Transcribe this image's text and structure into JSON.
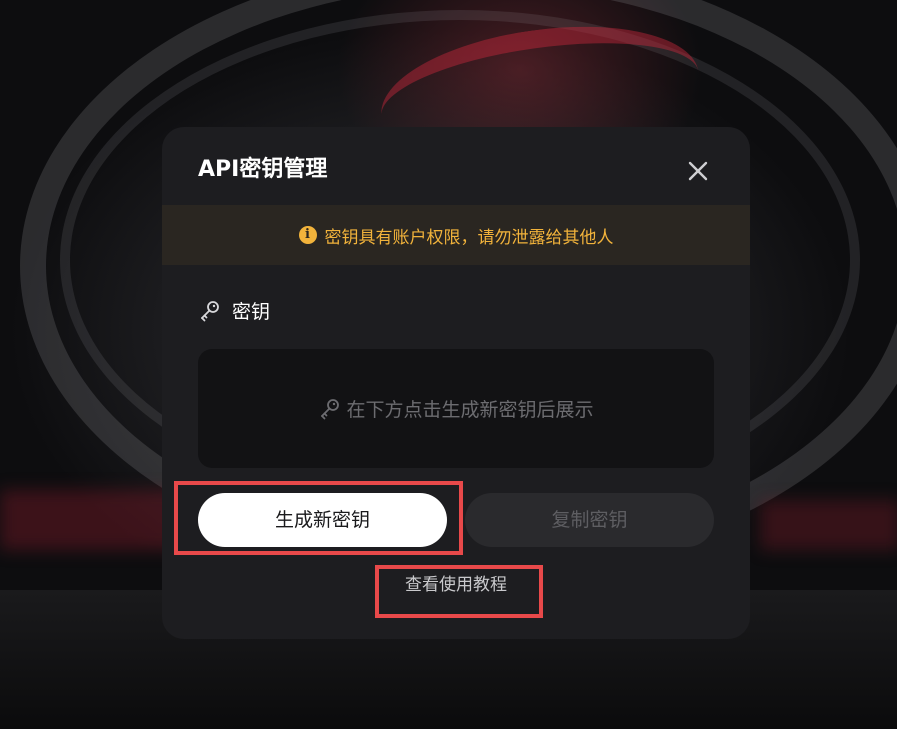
{
  "dialog": {
    "title": "API密钥管理",
    "close_icon": "close-icon"
  },
  "warning": {
    "icon": "info-icon",
    "text": "密钥具有账户权限，请勿泄露给其他人",
    "color": "#f2b33b"
  },
  "key_section": {
    "icon": "key-icon",
    "label": "密钥",
    "placeholder_icon": "key-icon",
    "placeholder": "在下方点击生成新密钥后展示"
  },
  "actions": {
    "generate_label": "生成新密钥",
    "copy_label": "复制密钥",
    "tutorial_label": "查看使用教程"
  },
  "highlight_color": "#e8494a"
}
